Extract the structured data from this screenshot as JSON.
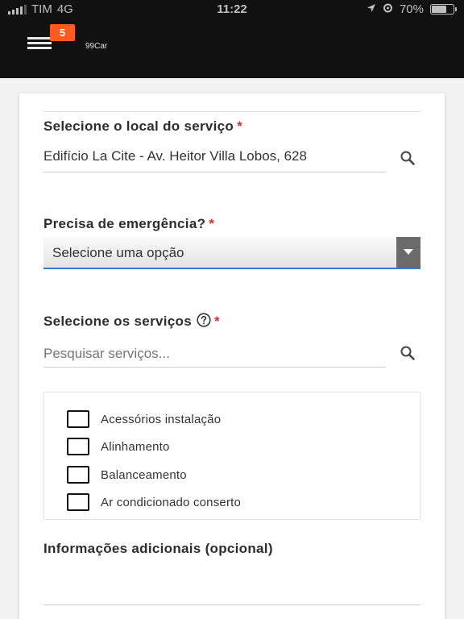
{
  "status_bar": {
    "carrier": "TIM",
    "network": "4G",
    "time": "11:22",
    "battery": "70%",
    "battery_level": 0.7
  },
  "header": {
    "notification_count": "5",
    "brand": "99Car"
  },
  "form": {
    "location": {
      "label": "Selecione o local do serviço",
      "required_mark": "*",
      "value": "Edifício La Cite - Av. Heitor Villa Lobos, 628"
    },
    "emergency": {
      "label": "Precisa de emergência?",
      "required_mark": "*",
      "selected": "Selecione uma opção"
    },
    "services": {
      "label": "Selecione os serviços",
      "required_mark": "*",
      "search_placeholder": "Pesquisar serviços...",
      "items": [
        {
          "label": "Acessórios instalação",
          "checked": false
        },
        {
          "label": "Alinhamento",
          "checked": false
        },
        {
          "label": "Balanceamento",
          "checked": false
        },
        {
          "label": "Ar condicionado conserto",
          "checked": false
        }
      ]
    },
    "additional_info": {
      "label": "Informações adicionais (opcional)",
      "value": ""
    }
  },
  "colors": {
    "header_bg": "#111111",
    "badge": "#ff5a1f",
    "required": "#d32f2f",
    "focus_underline": "#2f7fd0"
  }
}
